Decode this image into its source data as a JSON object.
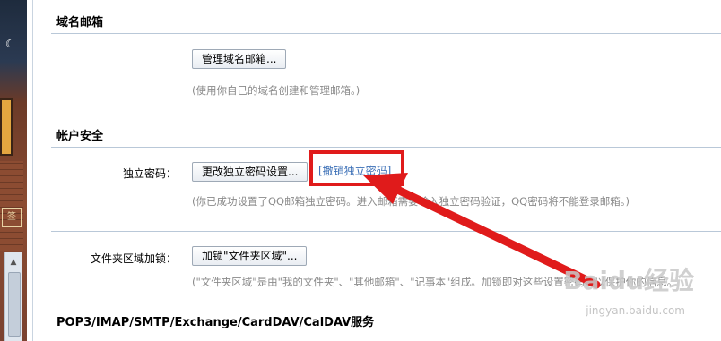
{
  "domain_mail": {
    "title": "域名邮箱",
    "manage_button": "管理域名邮箱...",
    "hint": "(使用你自己的域名创建和管理邮箱。)"
  },
  "account_security": {
    "title": "帐户安全",
    "independent_password_label": "独立密码：",
    "change_password_button": "更改独立密码设置...",
    "revoke_link": "[撤销独立密码]",
    "password_hint": "(你已成功设置了QQ邮箱独立密码。进入邮箱需要输入独立密码验证，QQ密码将不能登录邮箱。)",
    "folder_lock_label": "文件夹区域加锁：",
    "folder_lock_button": "加锁\"文件夹区域\"...",
    "folder_lock_hint": "(\"文件夹区域\"是由\"我的文件夹\"、\"其他邮箱\"、\"记事本\"组成。加锁即对这些设置密码，以保护你的信息。"
  },
  "pop3": {
    "title": "POP3/IMAP/SMTP/Exchange/CardDAV/CalDAV服务"
  },
  "watermark": {
    "text": "Baidu经验",
    "sub": "jingyan.baidu.com"
  },
  "left_strip": {
    "sign": "签"
  },
  "annotation_color": "#e01b1b"
}
